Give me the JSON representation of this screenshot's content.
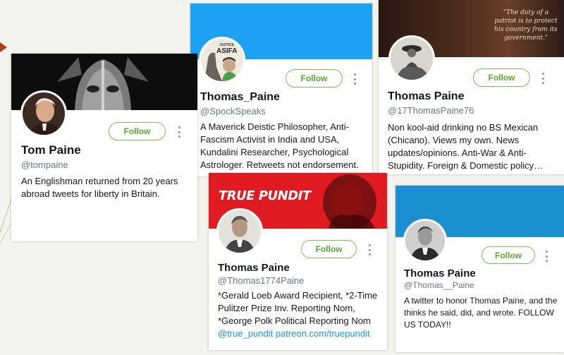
{
  "cards": [
    {
      "name": "Tom Paine",
      "handle": "@tompaine",
      "bio": "An Englishman returned from 20 years abroad tweets for liberty in Britain.",
      "follow_label": "Follow"
    },
    {
      "name": "Thomas_Paine",
      "handle": "@SpockSpeaks",
      "bio": "A Maverick Deistic Philosopher, Anti-Fascism Activist in India and USA, Kundalini Researcher, Psychological Astrologer. Retweets not endorsement.",
      "follow_label": "Follow",
      "avatar_text_1": "JUSTICE",
      "avatar_text_2": "ASIFA"
    },
    {
      "name": "Thomas Paine",
      "handle": "@17ThomasPaine76",
      "bio": "Non kool-aid drinking no BS Mexican (Chicano). Views my own. News updates/opinions. Anti-War & Anti-Stupidity. Foreign & Domestic policy…",
      "follow_label": "Follow",
      "banner_quote": "\"The duty of a patriot is to protect his country from its government.\""
    },
    {
      "name": "Thomas Paine",
      "handle": "@Thomas1774Paine",
      "bio": "*Gerald Loeb Award Recipient, *2-Time Pulitzer Prize Inv. Reporting Nom, *George Polk Political Reporting Nom",
      "bio_link": "@true_pundit patreon.com/truepundit",
      "follow_label": "Follow",
      "banner_text": "TRUE PUNDIT"
    },
    {
      "name": "Thomas Paine",
      "handle": "@Thomas__Paine",
      "bio": "A twitter to honor Thomas Paine, and the thinks he said, did, and wrote. FOLLOW US TODAY!!",
      "follow_label": "Follow"
    }
  ],
  "colors": {
    "follow_green": "#7cc04b",
    "twitter_blue": "#1da1f2",
    "link_blue": "#1b95e0",
    "pundit_red": "#e11b22"
  }
}
